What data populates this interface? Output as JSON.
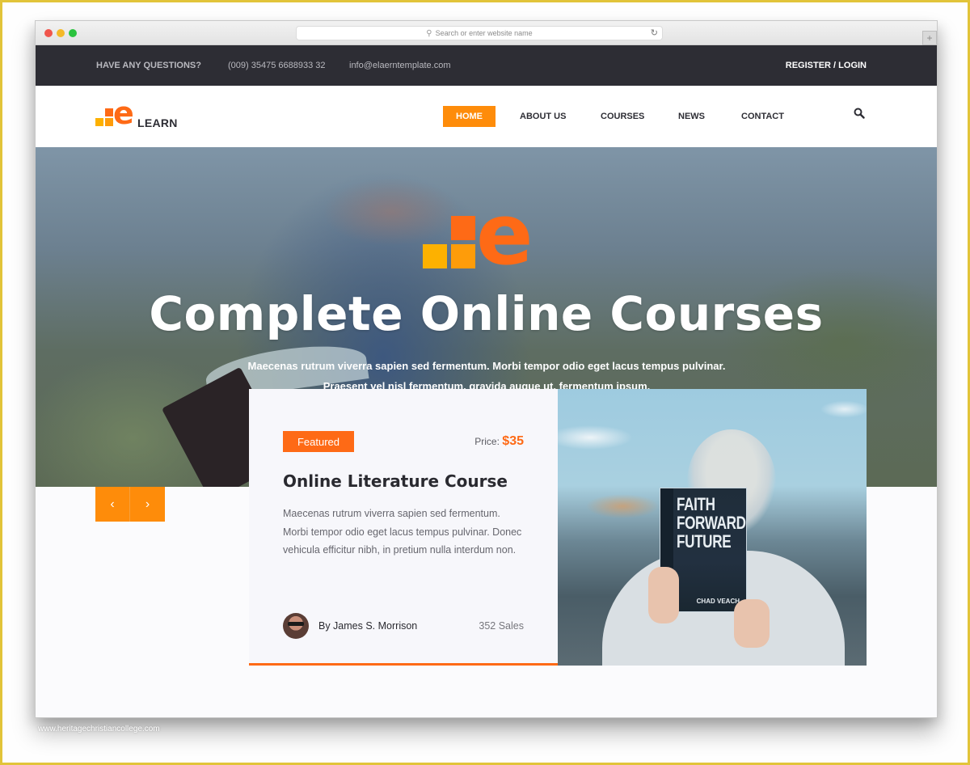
{
  "browser": {
    "address_placeholder": "Search or enter website name",
    "new_tab_label": "+"
  },
  "topbar": {
    "question": "HAVE ANY QUESTIONS?",
    "phone": "(009) 35475 6688933 32",
    "email": "info@elaerntemplate.com",
    "register_login": "REGISTER / LOGIN"
  },
  "logo": {
    "letter": "e",
    "text": "LEARN"
  },
  "nav": {
    "items": [
      {
        "label": "HOME",
        "active": true
      },
      {
        "label": "ABOUT US",
        "active": false
      },
      {
        "label": "COURSES",
        "active": false
      },
      {
        "label": "NEWS",
        "active": false
      },
      {
        "label": "CONTACT",
        "active": false
      }
    ],
    "search_icon": "search-icon"
  },
  "hero": {
    "logo_letter": "e",
    "title": "Complete Online Courses",
    "subtitle": "Maecenas rutrum viverra sapien sed fermentum. Morbi tempor odio eget lacus tempus pulvinar. Praesent vel nisl fermentum, gravida augue ut, fermentum ipsum."
  },
  "slider": {
    "prev_icon": "‹",
    "next_icon": "›"
  },
  "course_card": {
    "badge": "Featured",
    "price_label": "Price:",
    "price_value": "$35",
    "title": "Online Literature Course",
    "description": "Maecenas rutrum viverra sapien sed fermentum. Morbi tempor odio eget lacus tempus pulvinar. Donec vehicula efficitur nibh, in pretium nulla interdum non.",
    "author": "By James S. Morrison",
    "sales": "352 Sales",
    "image_book_title": "FAITH FORWARD FUTURE",
    "image_book_author": "CHAD VEACH"
  },
  "colors": {
    "accent_orange": "#fe8c0a",
    "brand_orange": "#fe6a16",
    "brand_yellow": "#fdb100",
    "topbar_bg": "#2d2d34"
  },
  "watermark": "www.heritagechristiancollege.com"
}
